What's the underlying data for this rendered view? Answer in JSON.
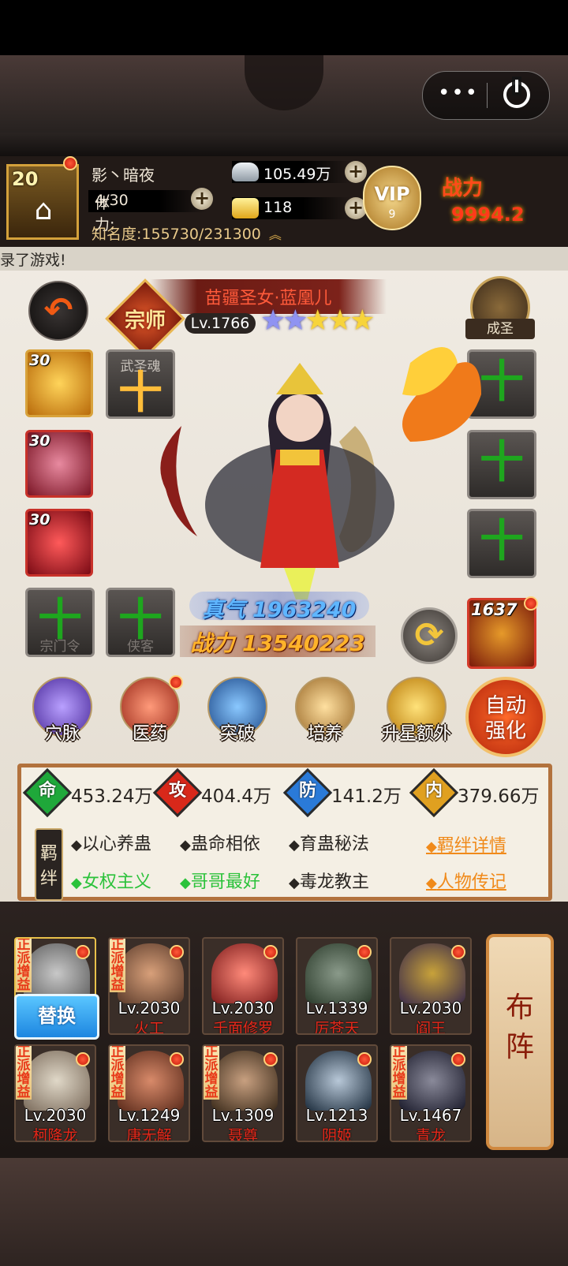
{
  "header": {
    "player_level": "20",
    "player_name": "影丶暗夜",
    "stamina_label": "体力:",
    "stamina_value": "4/30",
    "fame_label": "知名度:",
    "fame_value": "155730/231300",
    "silver": "105.49万",
    "gold": "118",
    "vip_label": "VIP",
    "vip_level": "9",
    "power_label": "战力",
    "power_value": "9994.2"
  },
  "capsule": {
    "menu": "•••"
  },
  "marquee": "录了游戏!",
  "hero": {
    "rank": "宗师",
    "name": "苗疆圣女·蓝凰儿",
    "level": "Lv.1766",
    "stars_blue": "★★",
    "stars_gold": "★★★",
    "ascend_label": "成圣",
    "zhenqi": "真气 1963240",
    "zhanli": "战力 13540223"
  },
  "skills": [
    {
      "level": "30"
    },
    {
      "level": "30"
    },
    {
      "level": "30"
    }
  ],
  "slots": {
    "wushenghun": "武圣魂",
    "cross": "十",
    "zongmenling": "宗门令",
    "xiake": "侠客"
  },
  "beast": {
    "level": "1637"
  },
  "functions": [
    {
      "label": "穴脉",
      "color": "#8a6ad8"
    },
    {
      "label": "医药",
      "color": "#d8503a"
    },
    {
      "label": "突破",
      "color": "#3a8ad8"
    },
    {
      "label": "培养",
      "color": "#d89a3a"
    },
    {
      "label": "升星额外",
      "color": "#e0b030"
    }
  ],
  "auto": {
    "line1": "自动",
    "line2": "强化"
  },
  "stats": [
    {
      "icon": "命",
      "value": "453.24万",
      "color": "#1fa83a"
    },
    {
      "icon": "攻",
      "value": "404.4万",
      "color": "#d8281a"
    },
    {
      "icon": "防",
      "value": "141.2万",
      "color": "#2a7ad8"
    },
    {
      "icon": "内",
      "value": "379.66万",
      "color": "#e0a020"
    }
  ],
  "bonds": {
    "label": "羁绊",
    "row1": [
      "以心养蛊",
      "蛊命相依",
      "育蛊秘法"
    ],
    "row2": [
      "女权主义",
      "哥哥最好",
      "毒龙教主"
    ],
    "detail_link": "羁绊详情",
    "bio_link": "人物传记"
  },
  "team_row1": [
    {
      "tag": "正派增益",
      "level": "",
      "name": ""
    },
    {
      "tag": "正派增益",
      "level": "Lv.2030",
      "name": "火工"
    },
    {
      "tag": "",
      "level": "Lv.2030",
      "name": "千面修罗"
    },
    {
      "tag": "",
      "level": "Lv.1339",
      "name": "厉苍天"
    },
    {
      "tag": "",
      "level": "Lv.2030",
      "name": "阎王"
    }
  ],
  "team_row2": [
    {
      "tag": "正派增益",
      "level": "Lv.2030",
      "name": "柯降龙"
    },
    {
      "tag": "正派增益",
      "level": "Lv.1249",
      "name": "唐无解"
    },
    {
      "tag": "正派增益",
      "level": "Lv.1309",
      "name": "聂尊"
    },
    {
      "tag": "",
      "level": "Lv.1213",
      "name": "阴姬"
    },
    {
      "tag": "正派增益",
      "level": "Lv.1467",
      "name": "青龙"
    }
  ],
  "swap_label": "替换",
  "formation": {
    "c1": "布",
    "c2": "阵"
  }
}
